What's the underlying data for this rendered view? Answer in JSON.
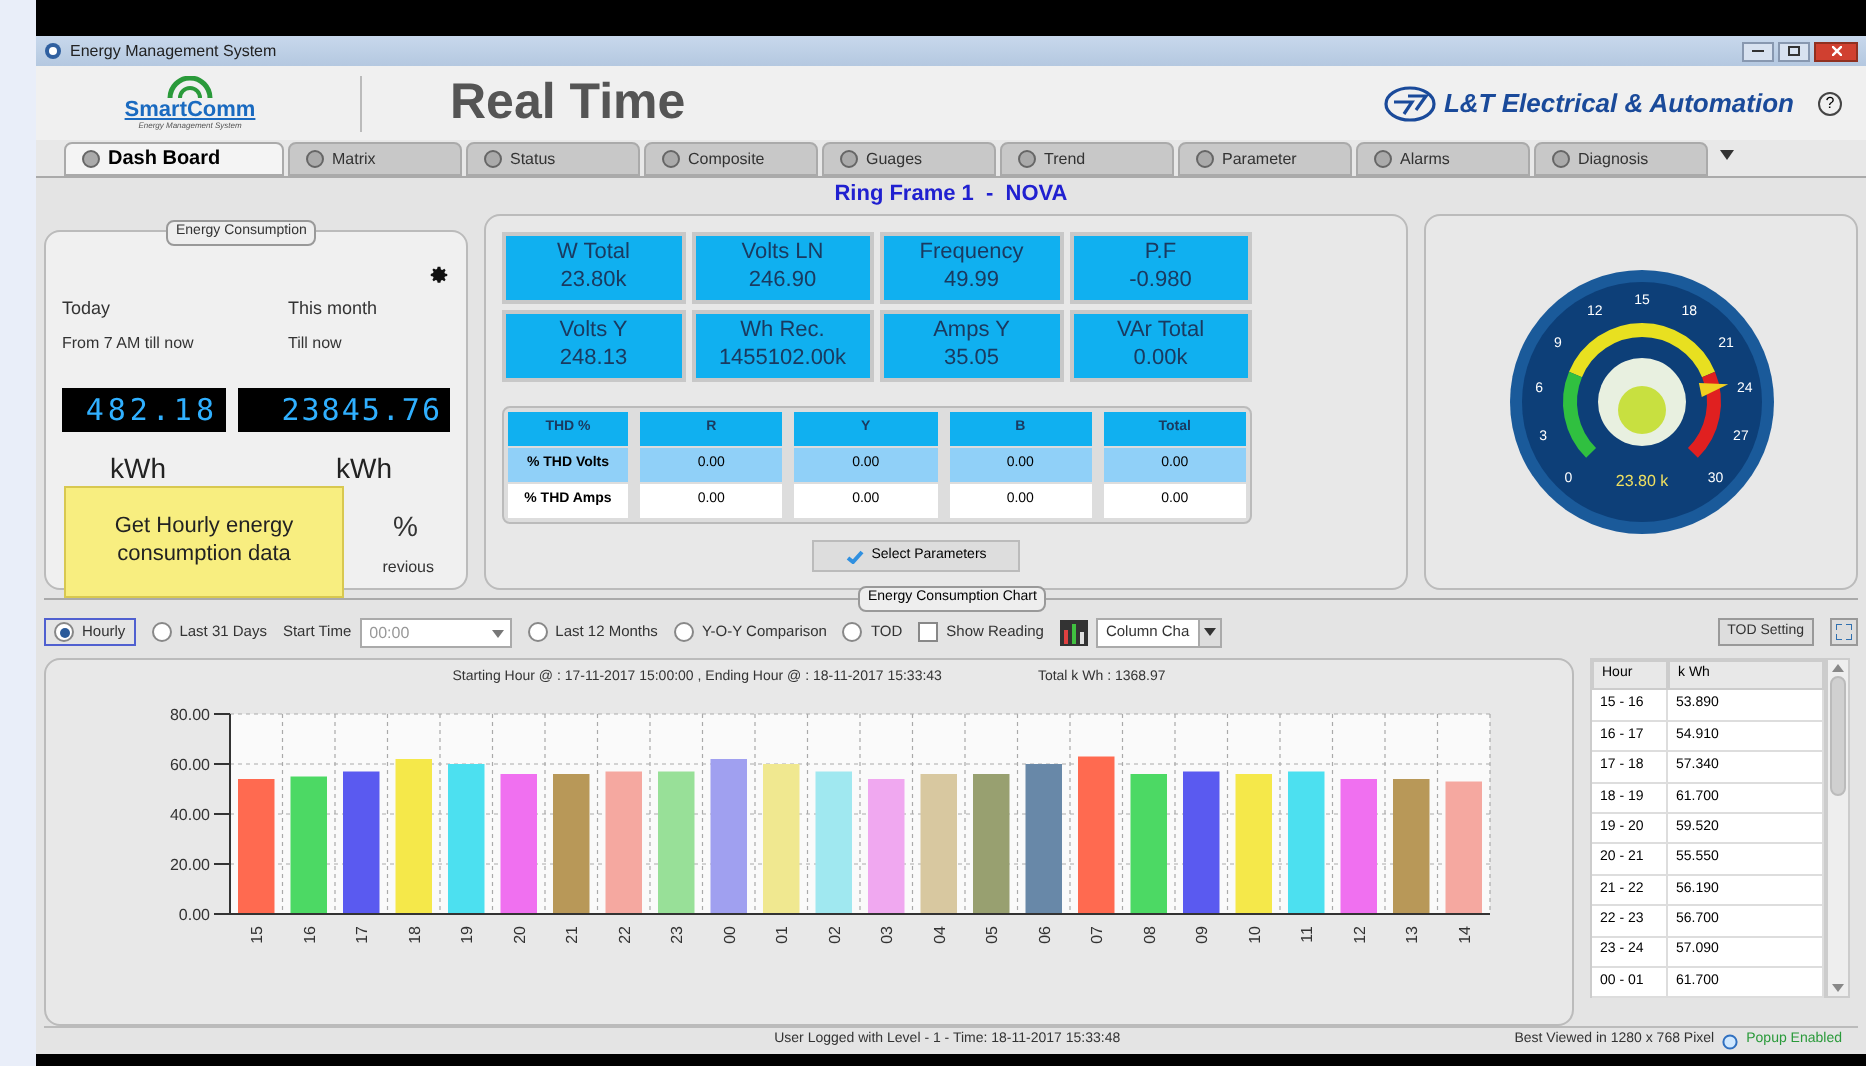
{
  "window": {
    "title": "Energy Management System"
  },
  "header": {
    "logo_text": "SmartComm",
    "logo_subtitle": "Energy Management System",
    "title": "Real Time",
    "brand": "L&T Electrical & Automation",
    "help": "?"
  },
  "tabs": [
    {
      "label": "Dash Board",
      "selected": true
    },
    {
      "label": "Matrix",
      "selected": false
    },
    {
      "label": "Status",
      "selected": false
    },
    {
      "label": "Composite",
      "selected": false
    },
    {
      "label": "Guages",
      "selected": false
    },
    {
      "label": "Trend",
      "selected": false
    },
    {
      "label": "Parameter",
      "selected": false
    },
    {
      "label": "Alarms",
      "selected": false
    },
    {
      "label": "Diagnosis",
      "selected": false
    }
  ],
  "device_title": "Ring Frame 1  -  NOVA",
  "energy": {
    "legend": "Energy Consumption",
    "today_label": "Today",
    "today_sub": "From 7 AM till now",
    "month_label": "This month",
    "month_sub": "Till now",
    "today_value": "482.18",
    "month_value": "23845.76",
    "today_unit": "kWh",
    "month_unit": "kWh",
    "percent": "%",
    "previous": "revious"
  },
  "tooltip": "Get Hourly energy consumption data",
  "tiles": [
    {
      "label": "W Total",
      "value": "23.80k"
    },
    {
      "label": "Volts LN",
      "value": "246.90"
    },
    {
      "label": "Frequency",
      "value": "49.99"
    },
    {
      "label": "P.F",
      "value": "-0.980"
    },
    {
      "label": "Volts Y",
      "value": "248.13"
    },
    {
      "label": "Wh Rec.",
      "value": "1455102.00k"
    },
    {
      "label": "Amps Y",
      "value": "35.05"
    },
    {
      "label": "VAr Total",
      "value": "0.00k"
    }
  ],
  "thd": {
    "columns": [
      "THD %",
      "R",
      "Y",
      "B",
      "Total"
    ],
    "rows": [
      [
        "% THD Volts",
        "0.00",
        "0.00",
        "0.00",
        "0.00"
      ],
      [
        "% THD Amps",
        "0.00",
        "0.00",
        "0.00",
        "0.00"
      ]
    ]
  },
  "select_button": "Select Parameters",
  "gauge": {
    "ticks": [
      "0",
      "3",
      "6",
      "9",
      "12",
      "15",
      "18",
      "21",
      "24",
      "27",
      "30"
    ],
    "reading": "23.80 k",
    "level": 0.79
  },
  "chart_section": {
    "legend": "Energy Consumption Chart",
    "options": [
      {
        "kind": "radio",
        "label": "Hourly",
        "selected": true
      },
      {
        "kind": "radio",
        "label": "Last 31 Days",
        "selected": false
      },
      {
        "kind": "select",
        "label": "Start Time",
        "placeholder": "00:00"
      },
      {
        "kind": "radio",
        "label": "Last 12 Months",
        "selected": false
      },
      {
        "kind": "radio",
        "label": "Y-O-Y Comparison",
        "selected": false
      },
      {
        "kind": "radio",
        "label": "TOD",
        "selected": false
      },
      {
        "kind": "checkbox",
        "label": "Show Reading",
        "checked": false
      },
      {
        "kind": "chart_type",
        "label": "Column Cha"
      }
    ],
    "tod_button": "TOD Setting",
    "range_text": "Starting Hour @ : 17-11-2017 15:00:00 , Ending Hour @ : 18-11-2017 15:33:43",
    "total_text": "Total k Wh :  1368.97",
    "chart_data": {
      "type": "bar",
      "categories": [
        "15",
        "16",
        "17",
        "18",
        "19",
        "20",
        "21",
        "22",
        "23",
        "00",
        "01",
        "02",
        "03",
        "04",
        "05",
        "06",
        "07",
        "08",
        "09",
        "10",
        "11",
        "12",
        "13",
        "14"
      ],
      "series": [
        {
          "values": [
            54,
            55,
            57,
            62,
            60,
            56,
            56,
            57,
            57,
            62,
            60,
            57,
            54,
            56,
            56,
            60,
            63,
            56,
            57,
            56,
            57,
            54,
            54,
            53
          ]
        }
      ],
      "grid": true,
      "colors": [
        "#ff6a50",
        "#4cd964",
        "#5a5af0",
        "#f5e84a",
        "#4ce0f0",
        "#f070f0",
        "#b89858",
        "#f5a8a0",
        "#98e098",
        "#a0a0f0",
        "#f0e890",
        "#a0e8f0",
        "#f0a8f0",
        "#d8c8a0",
        "#98a070",
        "#6888a8",
        "#ff6a50",
        "#4cd964",
        "#5a5af0",
        "#f5e84a",
        "#4ce0f0",
        "#f070f0",
        "#b89858",
        "#f5a8a0"
      ],
      "ylim": [
        0,
        80
      ],
      "yticks": [
        {
          "value": 0,
          "label": "0.00"
        },
        {
          "value": 20,
          "label": "20.00"
        },
        {
          "value": 40,
          "label": "40.00"
        },
        {
          "value": 60,
          "label": "60.00"
        },
        {
          "value": 80,
          "label": "80.00"
        }
      ]
    },
    "table": {
      "columns": [
        "Hour",
        "k Wh"
      ],
      "rows": [
        [
          "15 - 16",
          "53.890"
        ],
        [
          "16 - 17",
          "54.910"
        ],
        [
          "17 - 18",
          "57.340"
        ],
        [
          "18 - 19",
          "61.700"
        ],
        [
          "19 - 20",
          "59.520"
        ],
        [
          "20 - 21",
          "55.550"
        ],
        [
          "21 - 22",
          "56.190"
        ],
        [
          "22 - 23",
          "56.700"
        ],
        [
          "23 - 24",
          "57.090"
        ],
        [
          "00 - 01",
          "61.700"
        ]
      ]
    }
  },
  "status_bar": {
    "user": "User Logged with Level - 1 - Time: 18-11-2017 15:33:48",
    "best": "Best Viewed in 1280 x 768 Pixel",
    "popup": "Popup Enabled"
  }
}
